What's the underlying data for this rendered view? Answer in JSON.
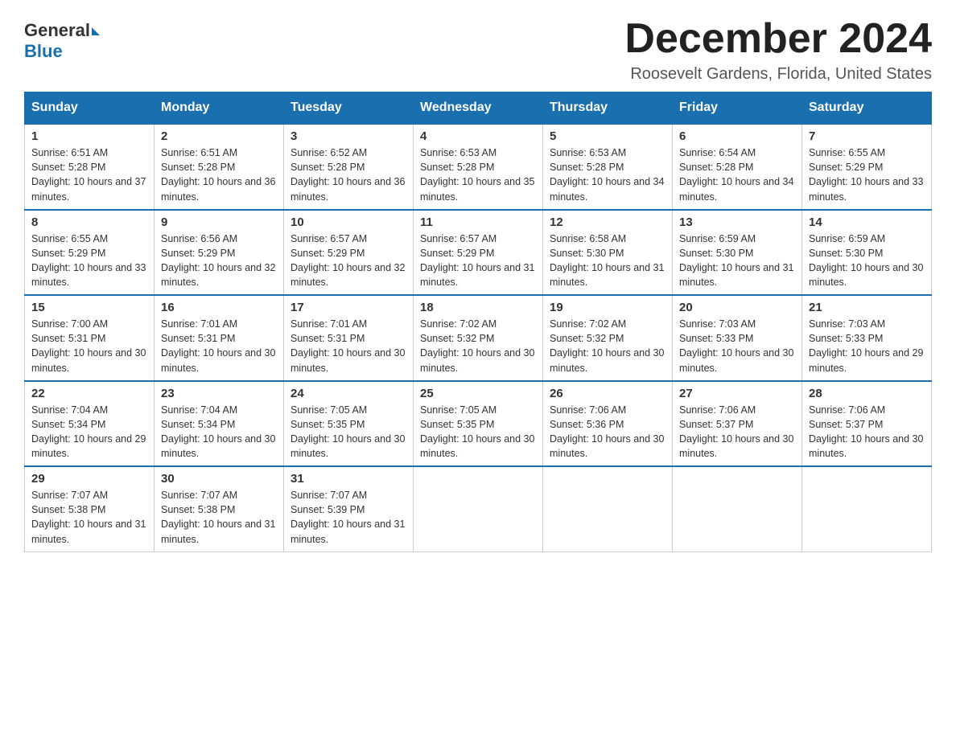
{
  "header": {
    "logo_general": "General",
    "logo_blue": "Blue",
    "month_title": "December 2024",
    "location": "Roosevelt Gardens, Florida, United States"
  },
  "weekdays": [
    "Sunday",
    "Monday",
    "Tuesday",
    "Wednesday",
    "Thursday",
    "Friday",
    "Saturday"
  ],
  "weeks": [
    [
      {
        "day": "1",
        "sunrise": "6:51 AM",
        "sunset": "5:28 PM",
        "daylight": "10 hours and 37 minutes."
      },
      {
        "day": "2",
        "sunrise": "6:51 AM",
        "sunset": "5:28 PM",
        "daylight": "10 hours and 36 minutes."
      },
      {
        "day": "3",
        "sunrise": "6:52 AM",
        "sunset": "5:28 PM",
        "daylight": "10 hours and 36 minutes."
      },
      {
        "day": "4",
        "sunrise": "6:53 AM",
        "sunset": "5:28 PM",
        "daylight": "10 hours and 35 minutes."
      },
      {
        "day": "5",
        "sunrise": "6:53 AM",
        "sunset": "5:28 PM",
        "daylight": "10 hours and 34 minutes."
      },
      {
        "day": "6",
        "sunrise": "6:54 AM",
        "sunset": "5:28 PM",
        "daylight": "10 hours and 34 minutes."
      },
      {
        "day": "7",
        "sunrise": "6:55 AM",
        "sunset": "5:29 PM",
        "daylight": "10 hours and 33 minutes."
      }
    ],
    [
      {
        "day": "8",
        "sunrise": "6:55 AM",
        "sunset": "5:29 PM",
        "daylight": "10 hours and 33 minutes."
      },
      {
        "day": "9",
        "sunrise": "6:56 AM",
        "sunset": "5:29 PM",
        "daylight": "10 hours and 32 minutes."
      },
      {
        "day": "10",
        "sunrise": "6:57 AM",
        "sunset": "5:29 PM",
        "daylight": "10 hours and 32 minutes."
      },
      {
        "day": "11",
        "sunrise": "6:57 AM",
        "sunset": "5:29 PM",
        "daylight": "10 hours and 31 minutes."
      },
      {
        "day": "12",
        "sunrise": "6:58 AM",
        "sunset": "5:30 PM",
        "daylight": "10 hours and 31 minutes."
      },
      {
        "day": "13",
        "sunrise": "6:59 AM",
        "sunset": "5:30 PM",
        "daylight": "10 hours and 31 minutes."
      },
      {
        "day": "14",
        "sunrise": "6:59 AM",
        "sunset": "5:30 PM",
        "daylight": "10 hours and 30 minutes."
      }
    ],
    [
      {
        "day": "15",
        "sunrise": "7:00 AM",
        "sunset": "5:31 PM",
        "daylight": "10 hours and 30 minutes."
      },
      {
        "day": "16",
        "sunrise": "7:01 AM",
        "sunset": "5:31 PM",
        "daylight": "10 hours and 30 minutes."
      },
      {
        "day": "17",
        "sunrise": "7:01 AM",
        "sunset": "5:31 PM",
        "daylight": "10 hours and 30 minutes."
      },
      {
        "day": "18",
        "sunrise": "7:02 AM",
        "sunset": "5:32 PM",
        "daylight": "10 hours and 30 minutes."
      },
      {
        "day": "19",
        "sunrise": "7:02 AM",
        "sunset": "5:32 PM",
        "daylight": "10 hours and 30 minutes."
      },
      {
        "day": "20",
        "sunrise": "7:03 AM",
        "sunset": "5:33 PM",
        "daylight": "10 hours and 30 minutes."
      },
      {
        "day": "21",
        "sunrise": "7:03 AM",
        "sunset": "5:33 PM",
        "daylight": "10 hours and 29 minutes."
      }
    ],
    [
      {
        "day": "22",
        "sunrise": "7:04 AM",
        "sunset": "5:34 PM",
        "daylight": "10 hours and 29 minutes."
      },
      {
        "day": "23",
        "sunrise": "7:04 AM",
        "sunset": "5:34 PM",
        "daylight": "10 hours and 30 minutes."
      },
      {
        "day": "24",
        "sunrise": "7:05 AM",
        "sunset": "5:35 PM",
        "daylight": "10 hours and 30 minutes."
      },
      {
        "day": "25",
        "sunrise": "7:05 AM",
        "sunset": "5:35 PM",
        "daylight": "10 hours and 30 minutes."
      },
      {
        "day": "26",
        "sunrise": "7:06 AM",
        "sunset": "5:36 PM",
        "daylight": "10 hours and 30 minutes."
      },
      {
        "day": "27",
        "sunrise": "7:06 AM",
        "sunset": "5:37 PM",
        "daylight": "10 hours and 30 minutes."
      },
      {
        "day": "28",
        "sunrise": "7:06 AM",
        "sunset": "5:37 PM",
        "daylight": "10 hours and 30 minutes."
      }
    ],
    [
      {
        "day": "29",
        "sunrise": "7:07 AM",
        "sunset": "5:38 PM",
        "daylight": "10 hours and 31 minutes."
      },
      {
        "day": "30",
        "sunrise": "7:07 AM",
        "sunset": "5:38 PM",
        "daylight": "10 hours and 31 minutes."
      },
      {
        "day": "31",
        "sunrise": "7:07 AM",
        "sunset": "5:39 PM",
        "daylight": "10 hours and 31 minutes."
      },
      null,
      null,
      null,
      null
    ]
  ],
  "labels": {
    "sunrise_prefix": "Sunrise: ",
    "sunset_prefix": "Sunset: ",
    "daylight_prefix": "Daylight: "
  }
}
